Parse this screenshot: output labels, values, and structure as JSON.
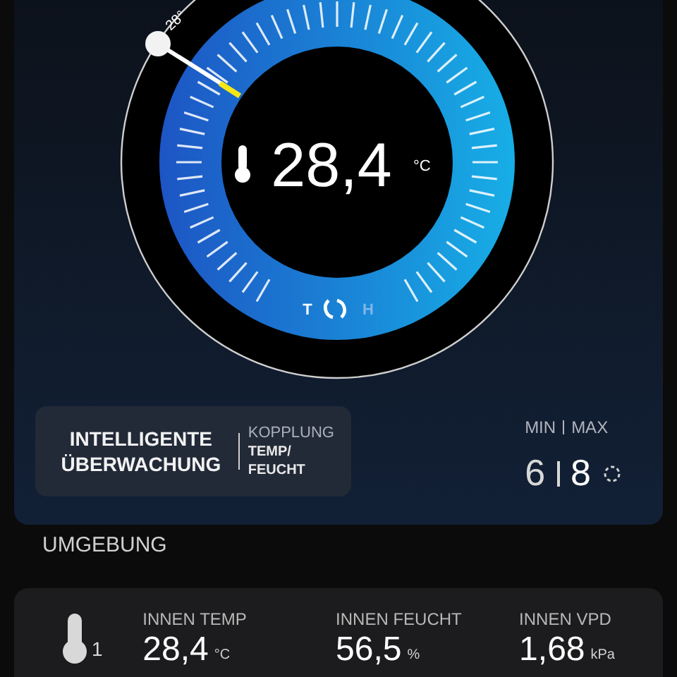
{
  "gauge": {
    "setpoint": "28°",
    "value": "28,4",
    "unit": "°C",
    "modes": [
      {
        "label": "T",
        "selected": true
      },
      {
        "label": "H",
        "selected": false
      }
    ]
  },
  "smart": {
    "title": "INTELLIGENTE ÜBERWACHUNG",
    "coupling_label": "KOPPLUNG",
    "coupling_value": "TEMP/ FEUCHT"
  },
  "minmax": {
    "label_min": "MIN",
    "label_max": "MAX",
    "min": "6",
    "max": "8"
  },
  "section": "UMGEBUNG",
  "sensor": {
    "index": "1",
    "readings": [
      {
        "label": "INNEN TEMP",
        "value": "28,4",
        "unit": "°C"
      },
      {
        "label": "INNEN FEUCHT",
        "value": "56,5",
        "unit": "%"
      },
      {
        "label": "INNEN VPD",
        "value": "1,68",
        "unit": "kPa"
      }
    ]
  }
}
